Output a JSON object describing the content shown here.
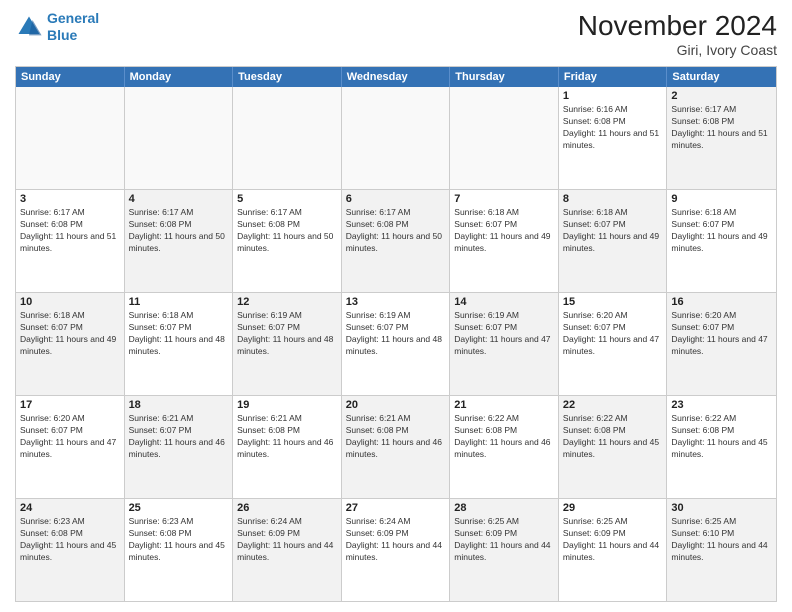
{
  "logo": {
    "line1": "General",
    "line2": "Blue"
  },
  "title": "November 2024",
  "location": "Giri, Ivory Coast",
  "header_days": [
    "Sunday",
    "Monday",
    "Tuesday",
    "Wednesday",
    "Thursday",
    "Friday",
    "Saturday"
  ],
  "weeks": [
    [
      {
        "day": "",
        "text": "",
        "empty": true
      },
      {
        "day": "",
        "text": "",
        "empty": true
      },
      {
        "day": "",
        "text": "",
        "empty": true
      },
      {
        "day": "",
        "text": "",
        "empty": true
      },
      {
        "day": "",
        "text": "",
        "empty": true
      },
      {
        "day": "1",
        "text": "Sunrise: 6:16 AM\nSunset: 6:08 PM\nDaylight: 11 hours and 51 minutes."
      },
      {
        "day": "2",
        "text": "Sunrise: 6:17 AM\nSunset: 6:08 PM\nDaylight: 11 hours and 51 minutes.",
        "shaded": true
      }
    ],
    [
      {
        "day": "3",
        "text": "Sunrise: 6:17 AM\nSunset: 6:08 PM\nDaylight: 11 hours and 51 minutes."
      },
      {
        "day": "4",
        "text": "Sunrise: 6:17 AM\nSunset: 6:08 PM\nDaylight: 11 hours and 50 minutes.",
        "shaded": true
      },
      {
        "day": "5",
        "text": "Sunrise: 6:17 AM\nSunset: 6:08 PM\nDaylight: 11 hours and 50 minutes."
      },
      {
        "day": "6",
        "text": "Sunrise: 6:17 AM\nSunset: 6:08 PM\nDaylight: 11 hours and 50 minutes.",
        "shaded": true
      },
      {
        "day": "7",
        "text": "Sunrise: 6:18 AM\nSunset: 6:07 PM\nDaylight: 11 hours and 49 minutes."
      },
      {
        "day": "8",
        "text": "Sunrise: 6:18 AM\nSunset: 6:07 PM\nDaylight: 11 hours and 49 minutes.",
        "shaded": true
      },
      {
        "day": "9",
        "text": "Sunrise: 6:18 AM\nSunset: 6:07 PM\nDaylight: 11 hours and 49 minutes."
      }
    ],
    [
      {
        "day": "10",
        "text": "Sunrise: 6:18 AM\nSunset: 6:07 PM\nDaylight: 11 hours and 49 minutes.",
        "shaded": true
      },
      {
        "day": "11",
        "text": "Sunrise: 6:18 AM\nSunset: 6:07 PM\nDaylight: 11 hours and 48 minutes."
      },
      {
        "day": "12",
        "text": "Sunrise: 6:19 AM\nSunset: 6:07 PM\nDaylight: 11 hours and 48 minutes.",
        "shaded": true
      },
      {
        "day": "13",
        "text": "Sunrise: 6:19 AM\nSunset: 6:07 PM\nDaylight: 11 hours and 48 minutes."
      },
      {
        "day": "14",
        "text": "Sunrise: 6:19 AM\nSunset: 6:07 PM\nDaylight: 11 hours and 47 minutes.",
        "shaded": true
      },
      {
        "day": "15",
        "text": "Sunrise: 6:20 AM\nSunset: 6:07 PM\nDaylight: 11 hours and 47 minutes."
      },
      {
        "day": "16",
        "text": "Sunrise: 6:20 AM\nSunset: 6:07 PM\nDaylight: 11 hours and 47 minutes.",
        "shaded": true
      }
    ],
    [
      {
        "day": "17",
        "text": "Sunrise: 6:20 AM\nSunset: 6:07 PM\nDaylight: 11 hours and 47 minutes."
      },
      {
        "day": "18",
        "text": "Sunrise: 6:21 AM\nSunset: 6:07 PM\nDaylight: 11 hours and 46 minutes.",
        "shaded": true
      },
      {
        "day": "19",
        "text": "Sunrise: 6:21 AM\nSunset: 6:08 PM\nDaylight: 11 hours and 46 minutes."
      },
      {
        "day": "20",
        "text": "Sunrise: 6:21 AM\nSunset: 6:08 PM\nDaylight: 11 hours and 46 minutes.",
        "shaded": true
      },
      {
        "day": "21",
        "text": "Sunrise: 6:22 AM\nSunset: 6:08 PM\nDaylight: 11 hours and 46 minutes."
      },
      {
        "day": "22",
        "text": "Sunrise: 6:22 AM\nSunset: 6:08 PM\nDaylight: 11 hours and 45 minutes.",
        "shaded": true
      },
      {
        "day": "23",
        "text": "Sunrise: 6:22 AM\nSunset: 6:08 PM\nDaylight: 11 hours and 45 minutes."
      }
    ],
    [
      {
        "day": "24",
        "text": "Sunrise: 6:23 AM\nSunset: 6:08 PM\nDaylight: 11 hours and 45 minutes.",
        "shaded": true
      },
      {
        "day": "25",
        "text": "Sunrise: 6:23 AM\nSunset: 6:08 PM\nDaylight: 11 hours and 45 minutes."
      },
      {
        "day": "26",
        "text": "Sunrise: 6:24 AM\nSunset: 6:09 PM\nDaylight: 11 hours and 44 minutes.",
        "shaded": true
      },
      {
        "day": "27",
        "text": "Sunrise: 6:24 AM\nSunset: 6:09 PM\nDaylight: 11 hours and 44 minutes."
      },
      {
        "day": "28",
        "text": "Sunrise: 6:25 AM\nSunset: 6:09 PM\nDaylight: 11 hours and 44 minutes.",
        "shaded": true
      },
      {
        "day": "29",
        "text": "Sunrise: 6:25 AM\nSunset: 6:09 PM\nDaylight: 11 hours and 44 minutes."
      },
      {
        "day": "30",
        "text": "Sunrise: 6:25 AM\nSunset: 6:10 PM\nDaylight: 11 hours and 44 minutes.",
        "shaded": true
      }
    ]
  ]
}
